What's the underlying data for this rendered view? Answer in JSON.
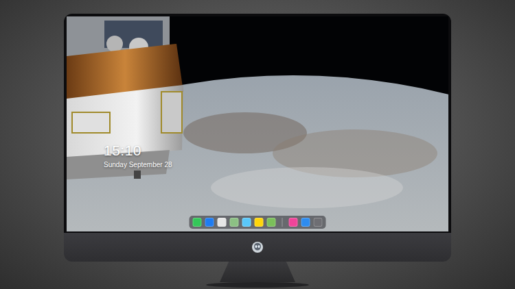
{
  "clock": {
    "time": "15:10",
    "date": "Sunday September 28"
  },
  "dock": {
    "items": [
      {
        "kind": "app",
        "color": "#34c759"
      },
      {
        "kind": "app",
        "color": "#1e7cf2"
      },
      {
        "kind": "app",
        "color": "#e6e6e6"
      },
      {
        "kind": "app",
        "color": "#8cc084"
      },
      {
        "kind": "app",
        "color": "#5ac8fa"
      },
      {
        "kind": "app",
        "color": "#ffd60a"
      },
      {
        "kind": "app",
        "color": "#7bbf5a"
      },
      {
        "kind": "separator"
      },
      {
        "kind": "app",
        "color": "#f0459a"
      },
      {
        "kind": "app",
        "color": "#2d8cf0"
      },
      {
        "kind": "app",
        "color": "#6e6e73"
      }
    ]
  }
}
